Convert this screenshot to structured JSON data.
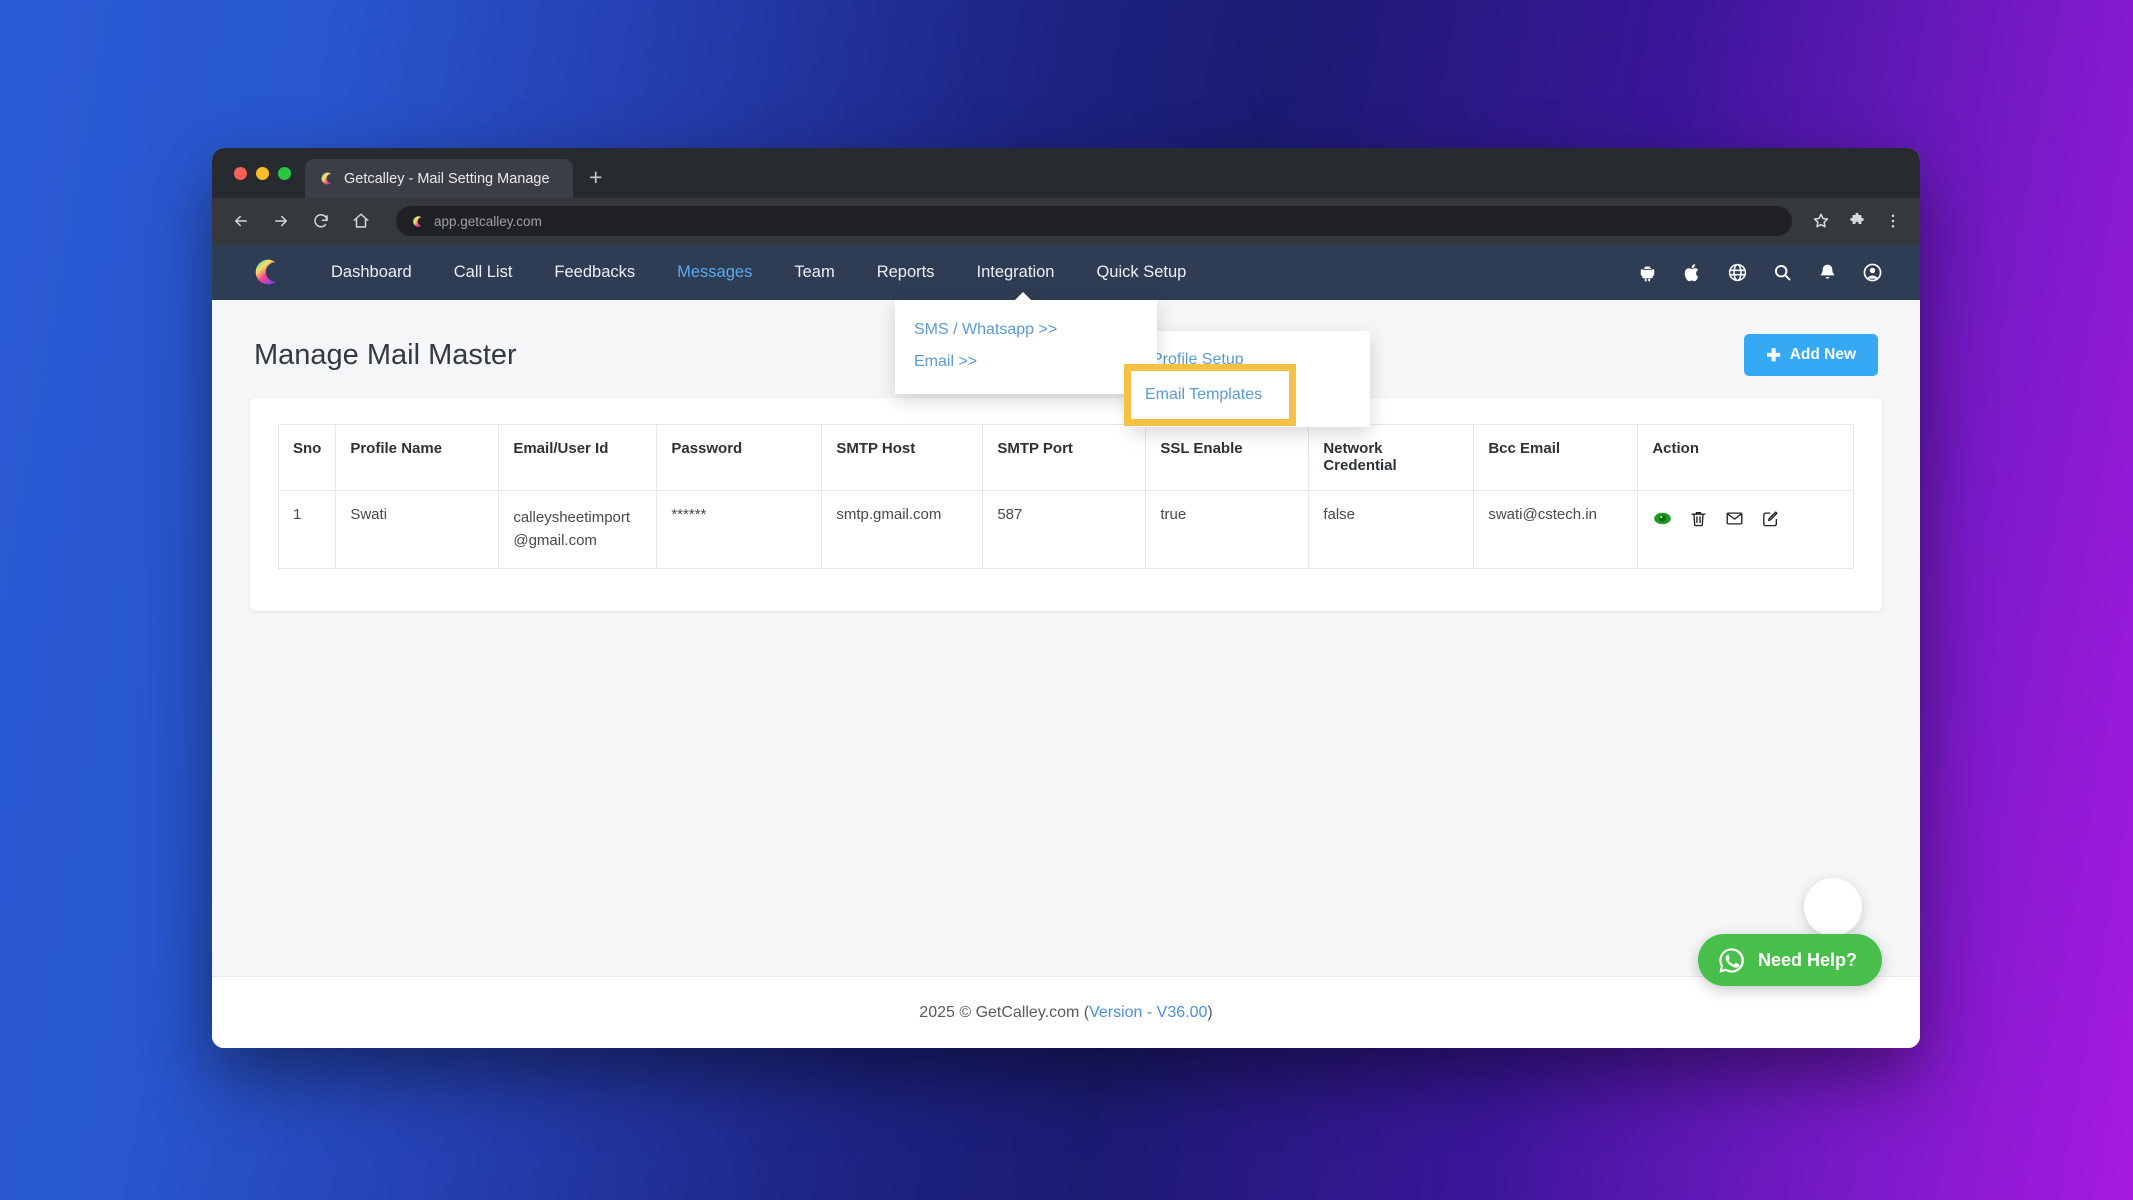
{
  "browser": {
    "tab_title": "Getcalley - Mail Setting Manage",
    "new_tab_label": "+",
    "url": "app.getcalley.com",
    "icons": {
      "back": "back-arrow-icon",
      "forward": "forward-arrow-icon",
      "reload": "reload-icon",
      "home": "home-icon",
      "bookmark": "star-icon",
      "extensions": "puzzle-icon",
      "menu": "three-dot-menu-icon"
    }
  },
  "navbar": {
    "logo": "calley-logo",
    "links": [
      {
        "label": "Dashboard",
        "active": false
      },
      {
        "label": "Call List",
        "active": false
      },
      {
        "label": "Feedbacks",
        "active": false
      },
      {
        "label": "Messages",
        "active": true
      },
      {
        "label": "Team",
        "active": false
      },
      {
        "label": "Reports",
        "active": false
      },
      {
        "label": "Integration",
        "active": false
      },
      {
        "label": "Quick Setup",
        "active": false
      }
    ],
    "icons": [
      "android-icon",
      "apple-icon",
      "globe-icon",
      "search-icon",
      "bell-icon",
      "user-avatar-icon"
    ]
  },
  "dropdown": {
    "items": [
      {
        "label": "SMS / Whatsapp >>"
      },
      {
        "label": "Email >>"
      }
    ]
  },
  "submenu": {
    "items": [
      {
        "label": "Profile Setup"
      },
      {
        "label": "Email Templates",
        "highlighted": true
      }
    ]
  },
  "page": {
    "title": "Manage Mail Master",
    "add_button": {
      "icon": "plus-icon",
      "label": "Add New"
    }
  },
  "table": {
    "columns": [
      "Sno",
      "Profile Name",
      "Email/User Id",
      "Password",
      "SMTP Host",
      "SMTP Port",
      "SSL Enable",
      "Network Credential",
      "Bcc Email",
      "Action"
    ],
    "rows": [
      {
        "sno": "1",
        "profile_name": "Swati",
        "email_user_id": "calleysheetimport@gmail.com",
        "password": "******",
        "smtp_host": "smtp.gmail.com",
        "smtp_port": "587",
        "ssl_enable": "true",
        "network_credential": "false",
        "bcc_email": "swati@cstech.in",
        "actions": [
          "view-eye-icon",
          "delete-trash-icon",
          "send-mail-icon",
          "edit-pencil-icon"
        ]
      }
    ]
  },
  "footer": {
    "copyright": "2025 © GetCalley.com (",
    "version_link": "Version - V36.00",
    "close_paren": ")"
  },
  "widgets": {
    "scroll_top": "scroll-to-top-button",
    "need_help": {
      "icon": "whatsapp-icon",
      "label": "Need Help?"
    }
  },
  "colors": {
    "navbar_bg": "#2e3c54",
    "accent_blue": "#36a9f5",
    "active_link": "#5aa9ef",
    "highlight_yellow": "#f3c144",
    "whatsapp_green": "#48bf4b",
    "eye_green": "#1f9b22"
  }
}
